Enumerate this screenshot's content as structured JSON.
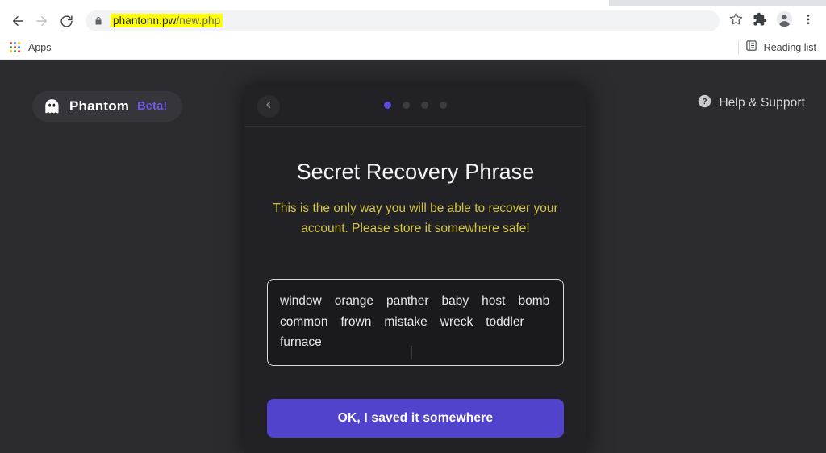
{
  "browser": {
    "back_icon": "arrow-left-icon",
    "forward_icon": "arrow-right-icon",
    "reload_icon": "reload-icon",
    "lock_icon": "lock-icon",
    "url_domain": "phantonn.pw",
    "url_path": "/new.php",
    "url_highlight_color": "#ffff00",
    "bookmark_icon": "star-icon",
    "extensions_icon": "puzzle-piece-icon",
    "profile_icon": "profile-avatar-icon",
    "menu_icon": "three-dot-menu-icon",
    "bookmarks": {
      "apps_label": "Apps",
      "apps_icon": "apps-grid-icon",
      "reading_list_label": "Reading list",
      "reading_list_icon": "reading-list-icon"
    }
  },
  "page": {
    "background_color": "#2b2b30",
    "brand": {
      "icon": "phantom-ghost-icon",
      "name": "Phantom",
      "beta_label": "Beta!",
      "beta_color": "#6f5ce0"
    },
    "help": {
      "icon": "question-circle-icon",
      "label": "Help & Support"
    }
  },
  "modal": {
    "background_color": "#222226",
    "back_button_icon": "chevron-left-icon",
    "pagination": {
      "total": 4,
      "active_index": 0,
      "active_color": "#5b4ae0",
      "inactive_color": "#3b3b41"
    },
    "title": "Secret Recovery Phrase",
    "warning": "This is the only way you will be able to recover your account. Please store it somewhere safe!",
    "warning_color": "#d2c545",
    "seed_phrase": {
      "words": [
        "window",
        "orange",
        "panther",
        "baby",
        "host",
        "bomb",
        "common",
        "frown",
        "mistake",
        "wreck",
        "toddler",
        "furnace"
      ],
      "border_color": "#d9d9dc",
      "background_color": "#1a1a1c"
    },
    "cta": {
      "label": "OK, I saved it somewhere",
      "color": "#5243cc"
    }
  }
}
